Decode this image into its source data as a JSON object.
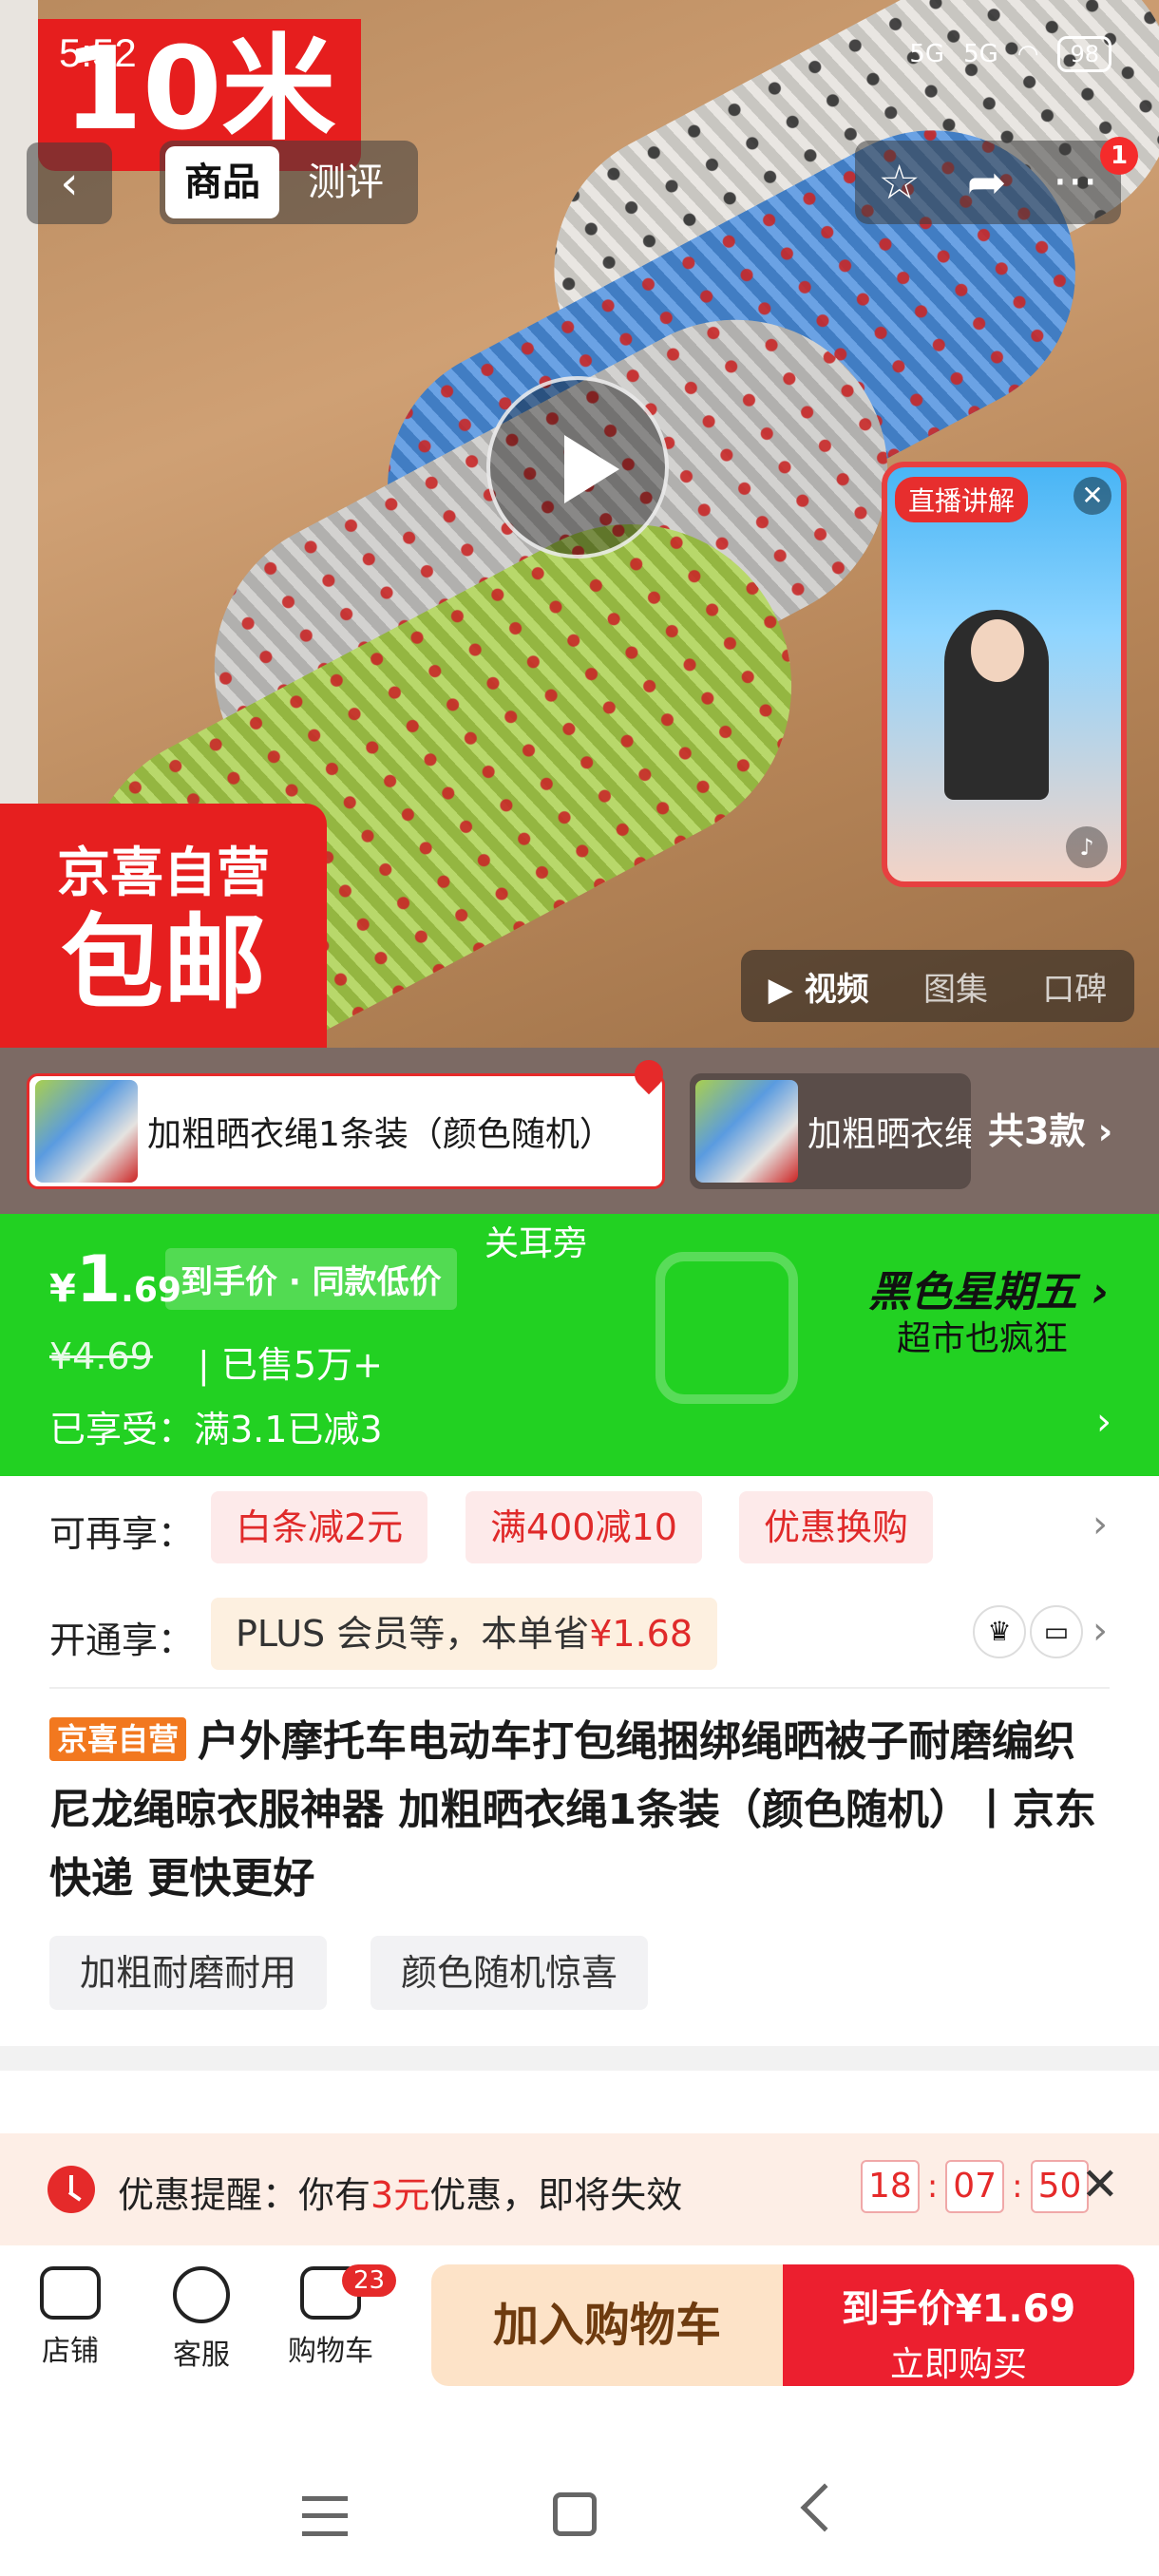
{
  "status_bar": {
    "time": "5:52",
    "signal_1": "5G",
    "signal_2": "5G",
    "battery": "98"
  },
  "hero": {
    "length_tag": "10米",
    "promo_line1": "京喜自营",
    "promo_line2": "包邮",
    "media_tabs": [
      "视频",
      "图集",
      "口碑"
    ],
    "live_label": "直播讲解"
  },
  "nav": {
    "back_icon": "chevron-left-icon",
    "tabs": [
      "商品",
      "测评"
    ],
    "notification_count": "1"
  },
  "variants": {
    "items": [
      "加粗晒衣绳1条装（颜色随机）",
      "加粗晒衣绳"
    ],
    "count_label": "共3款"
  },
  "price": {
    "currency": "¥",
    "integer": "1",
    "decimal": ".69",
    "chip": "到手价 · 同款低价",
    "guan_er": "关耳旁",
    "original": "¥4.69",
    "sold": "已售5万+",
    "enjoyed": "已享受：满3.1已减3",
    "black_friday_title": "黑色星期五",
    "black_friday_sub": "超市也疯狂",
    "accent_color": "#22d122"
  },
  "offers": {
    "more_label": "可再享：",
    "chips": [
      "白条减2元",
      "满400减10",
      "优惠换购"
    ],
    "plus_label": "开通享：",
    "plus_text": "PLUS 会员等，本单省",
    "plus_amount": "¥1.68"
  },
  "product": {
    "tag": "京喜自营",
    "title": "户外摩托车电动车打包绳捆绑绳晒被子耐磨编织尼龙绳晾衣服神器 加粗晒衣绳1条装（颜色随机）丨京东快递 更快更好",
    "features": [
      "加粗耐磨耐用",
      "颜色随机惊喜"
    ]
  },
  "reminder": {
    "prefix": "优惠提醒：你有",
    "amount": "3元",
    "suffix": "优惠，即将失效",
    "countdown": [
      "18",
      "07",
      "50"
    ]
  },
  "bottom_bar": {
    "store": "店铺",
    "service": "客服",
    "cart": "购物车",
    "cart_count": "23",
    "add_to_cart": "加入购物车",
    "buy_price_label": "到手价¥1.69",
    "buy_now": "立即购买"
  }
}
